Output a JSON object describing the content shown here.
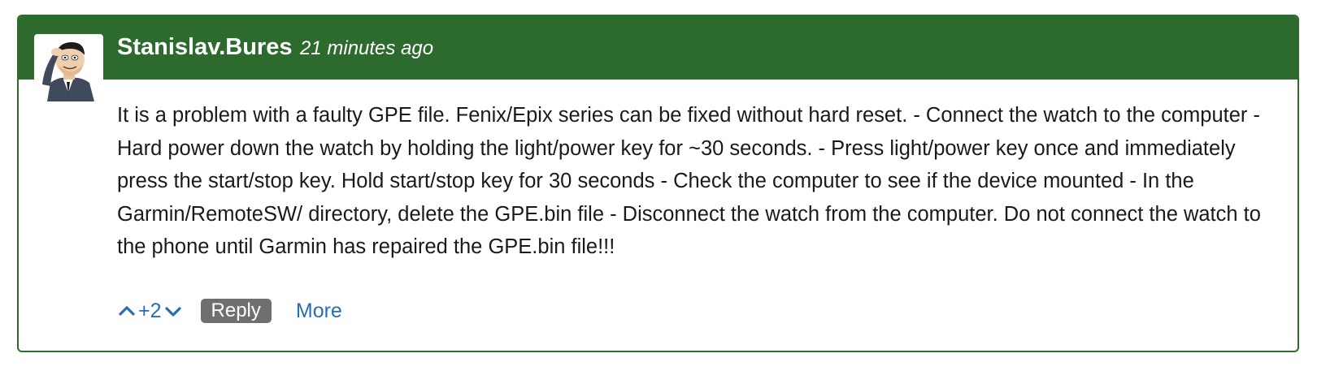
{
  "post": {
    "author": "Stanislav.Bures",
    "timestamp": "21 minutes ago",
    "body": "It is a problem with a faulty GPE file. Fenix/Epix series can be fixed without hard reset. - Connect the watch to the computer - Hard power down the watch by holding the light/power key for ~30 seconds. - Press light/power key once and immediately press the start/stop key. Hold start/stop key for 30 seconds - Check the computer to see if the device mounted - In the Garmin/RemoteSW/ directory, delete the GPE.bin file - Disconnect the watch from the computer. Do not connect the watch to the phone until Garmin has repaired the GPE.bin file!!!",
    "avatar_icon": "cartoon-man-avatar"
  },
  "actions": {
    "vote_up_icon": "chevron-up-icon",
    "vote_count": "+2",
    "vote_down_icon": "chevron-down-icon",
    "reply_label": "Reply",
    "more_label": "More"
  },
  "colors": {
    "header_green": "#2d6a2d",
    "link_blue": "#2a6db3",
    "reply_gray": "#6f6f6f"
  }
}
